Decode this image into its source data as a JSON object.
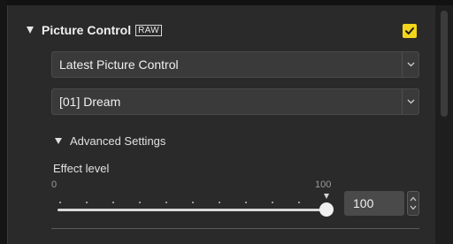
{
  "picture_control": {
    "title": "Picture Control",
    "raw_badge": "RAW",
    "enabled": true,
    "accent_color": "#f3d51c"
  },
  "dropdowns": {
    "mode": {
      "value": "Latest Picture Control"
    },
    "preset": {
      "value": "[01] Dream"
    }
  },
  "advanced": {
    "label": "Advanced Settings"
  },
  "effect": {
    "label": "Effect level",
    "min_label": "0",
    "max_label": "100",
    "value": "100",
    "min": 0,
    "max": 100,
    "current": 100
  },
  "icons": {
    "section_toggle": "triangle-down-icon",
    "checkbox": "checkmark-icon",
    "dropdown": "chevron-down-icon",
    "stepper": "up-down-arrows-icon"
  }
}
